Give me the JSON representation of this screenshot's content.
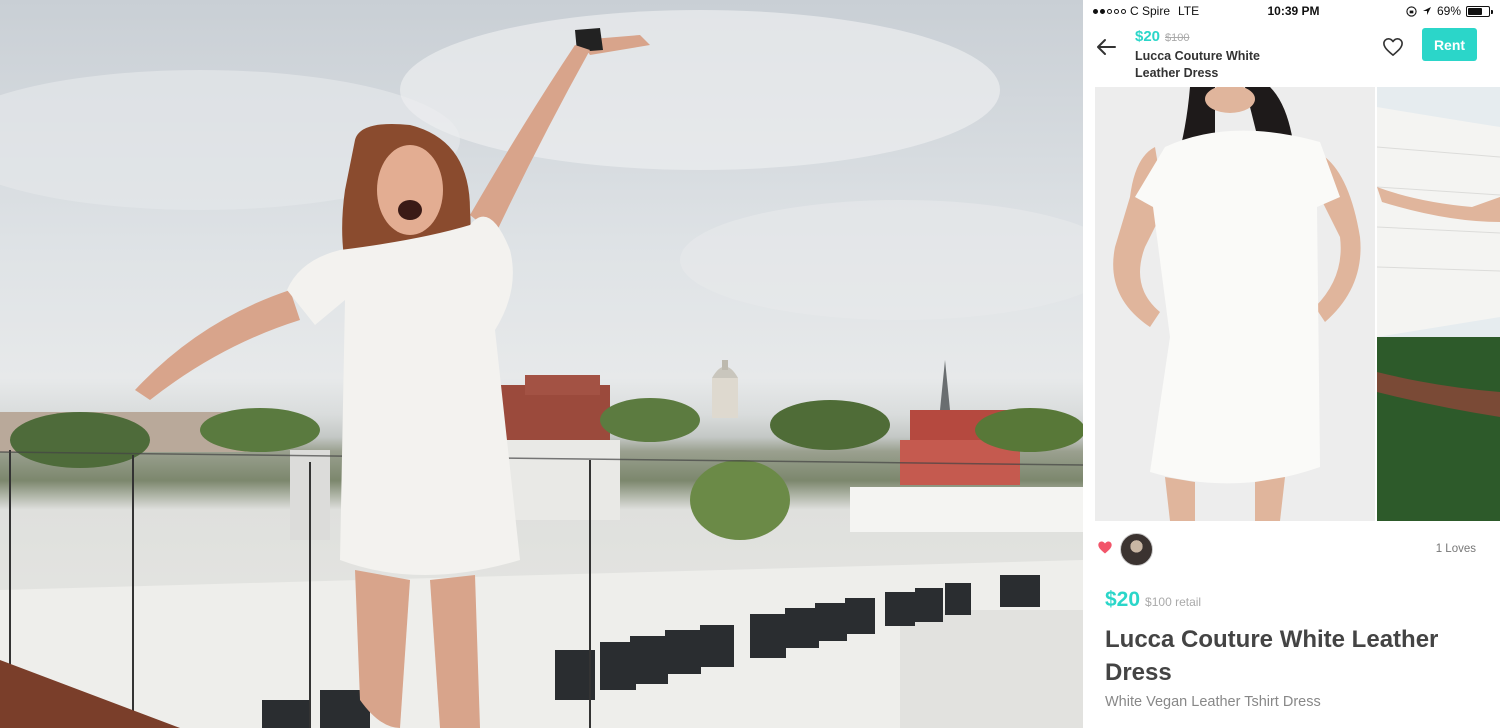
{
  "status_bar": {
    "carrier": "C Spire",
    "network": "LTE",
    "time": "10:39 PM",
    "battery": "69%",
    "battery_level": 0.69
  },
  "header": {
    "price": "$20",
    "retail_price": "$100",
    "title": "Lucca Couture White Leather Dress",
    "rent_label": "Rent"
  },
  "meta": {
    "loves": "1 Loves"
  },
  "detail": {
    "price": "$20",
    "retail": "$100 retail",
    "title": "Lucca Couture White Leather Dress",
    "subtitle": "White Vegan Leather Tshirt Dress"
  },
  "colors": {
    "accent": "#2bd6c9",
    "love": "#f2556a"
  },
  "icons": [
    "back-arrow-icon",
    "heart-outline-icon",
    "heart-filled-icon",
    "location-icon",
    "battery-icon"
  ]
}
